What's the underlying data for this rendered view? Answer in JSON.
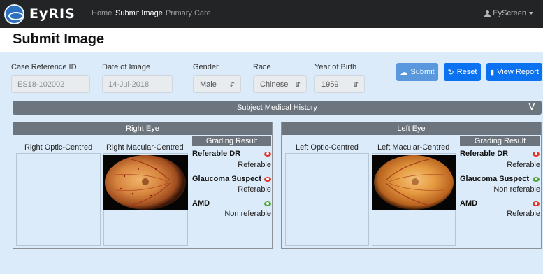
{
  "navbar": {
    "brand": "EyRIS",
    "links": [
      "Home",
      "Submit Image",
      "Primary Care"
    ],
    "user": "EyScreen"
  },
  "page": {
    "title": "Submit Image"
  },
  "form": {
    "case_reference": {
      "label": "Case Reference ID",
      "value": "ES18-102002"
    },
    "date_of_image": {
      "label": "Date of Image",
      "value": "14-Jul-2018"
    },
    "gender": {
      "label": "Gender",
      "value": "Male"
    },
    "race": {
      "label": "Race",
      "value": "Chinese"
    },
    "year_of_birth": {
      "label": "Year of Birth",
      "value": "1959"
    }
  },
  "buttons": {
    "submit": "Submit",
    "reset": "Reset",
    "view_report": "View Report"
  },
  "history": {
    "label": "Subject Medical History"
  },
  "right_eye": {
    "title": "Right Eye",
    "optic_label": "Right Optic-Centred",
    "macular_label": "Right Macular-Centred",
    "grading_title": "Grading Result",
    "results": [
      {
        "name": "Referable DR",
        "value": "Referable",
        "status": "red"
      },
      {
        "name": "Glaucoma Suspect",
        "value": "Referable",
        "status": "red"
      },
      {
        "name": "AMD",
        "value": "Non referable",
        "status": "green"
      }
    ]
  },
  "left_eye": {
    "title": "Left Eye",
    "optic_label": "Left Optic-Centred",
    "macular_label": "Left Macular-Centred",
    "grading_title": "Grading Result",
    "results": [
      {
        "name": "Referable DR",
        "value": "Referable",
        "status": "red"
      },
      {
        "name": "Glaucoma Suspect",
        "value": "Non referable",
        "status": "green"
      },
      {
        "name": "AMD",
        "value": "Referable",
        "status": "red"
      }
    ]
  },
  "colors": {
    "navbar": "#222426",
    "panel": "#dcebf9",
    "primary": "#0a72f0",
    "header_gray": "#6c757d",
    "status_red": "#e0362c",
    "status_green": "#4fa83d"
  }
}
